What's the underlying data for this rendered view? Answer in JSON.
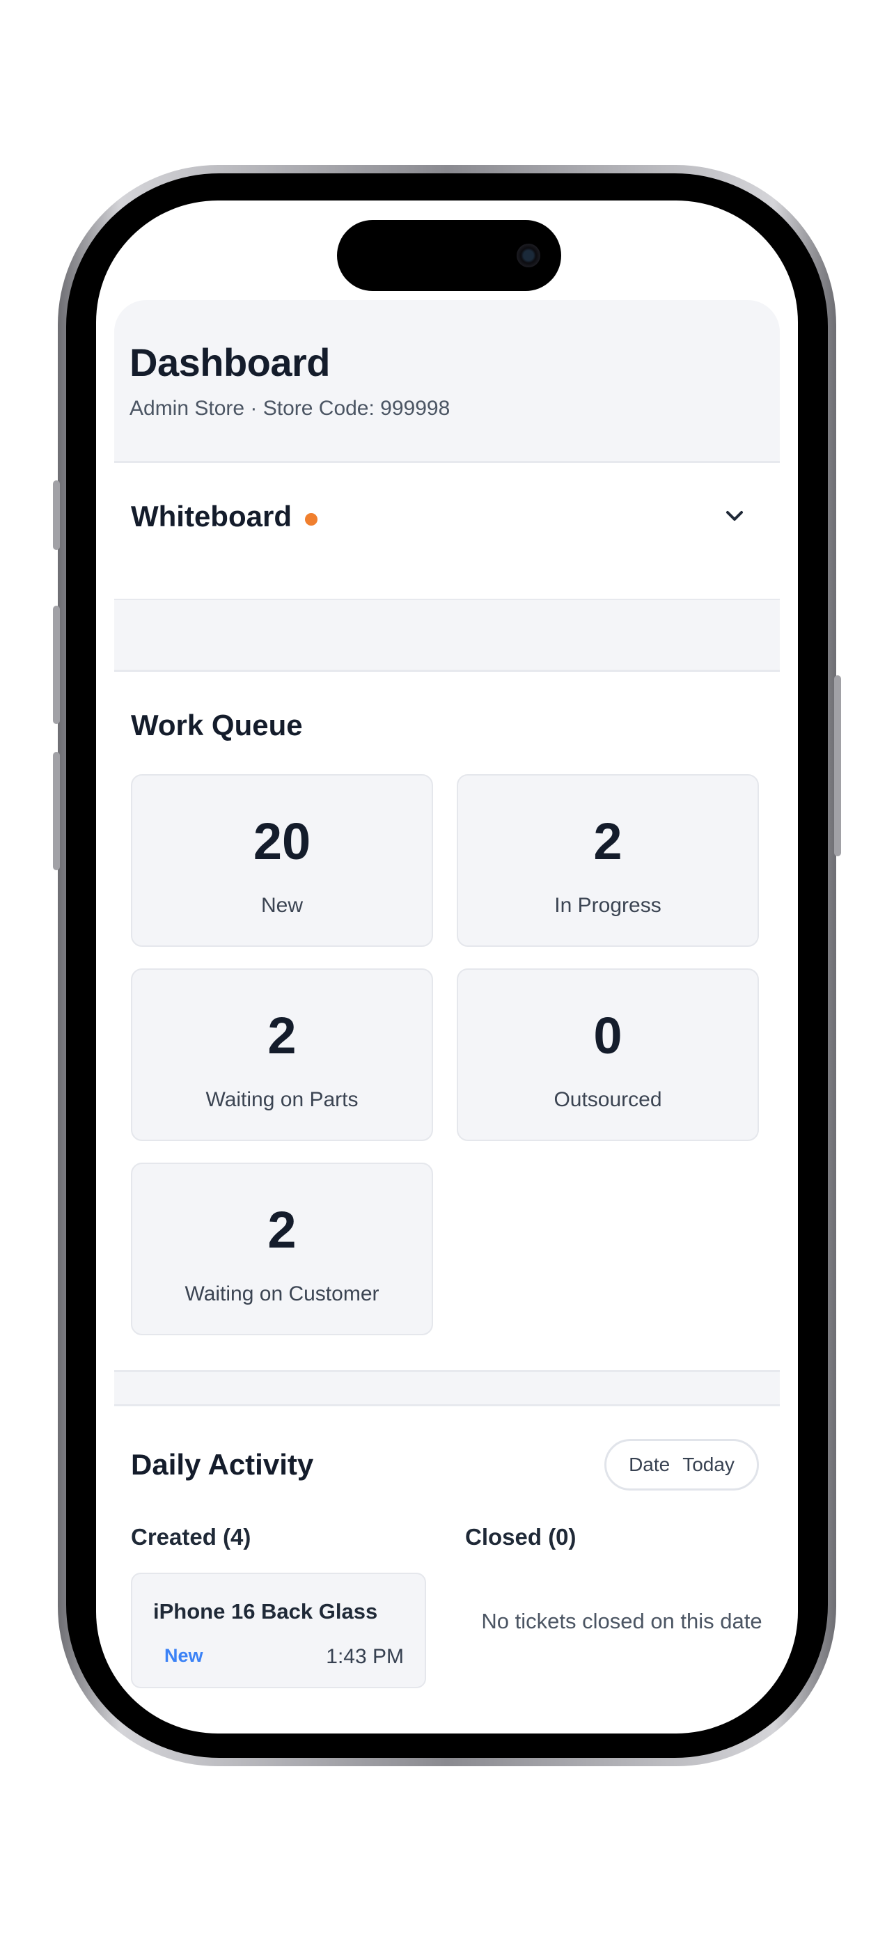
{
  "header": {
    "title": "Dashboard",
    "subtitle": "Admin Store · Store Code: 999998"
  },
  "whiteboard": {
    "title": "Whiteboard",
    "status_color": "#f07f2e",
    "toggle_icon": "chevron-down-icon"
  },
  "work_queue": {
    "title": "Work Queue",
    "tiles": [
      {
        "count": "20",
        "label": "New"
      },
      {
        "count": "2",
        "label": "In Progress"
      },
      {
        "count": "2",
        "label": "Waiting on Parts"
      },
      {
        "count": "0",
        "label": "Outsourced"
      },
      {
        "count": "2",
        "label": "Waiting on Customer"
      }
    ]
  },
  "daily_activity": {
    "title": "Daily Activity",
    "date_label": "Date",
    "date_value": "Today",
    "created_heading": "Created (4)",
    "closed_heading": "Closed (0)",
    "created_tickets": [
      {
        "title": "iPhone 16 Back Glass",
        "status": "New",
        "time": "1:43 PM",
        "status_color": "#3b82f6"
      }
    ],
    "closed_empty_text": "No tickets closed on this date"
  }
}
